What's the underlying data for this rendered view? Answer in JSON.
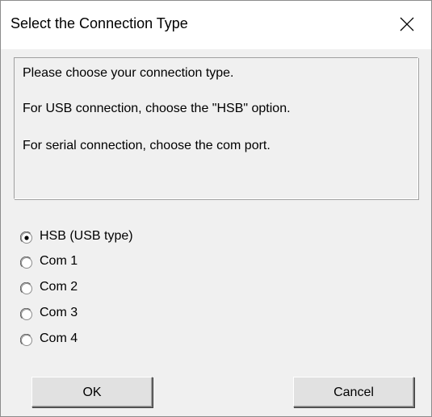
{
  "dialog": {
    "title": "Select the Connection Type",
    "close_icon": "close-icon"
  },
  "message": {
    "line1": "Please choose your connection type.",
    "line2": "For USB connection, choose the \"HSB\" option.",
    "line3": "For serial connection, choose the com port."
  },
  "options": {
    "selected_index": 0,
    "items": [
      {
        "label": "HSB (USB type)",
        "selected": true
      },
      {
        "label": "Com 1",
        "selected": false
      },
      {
        "label": "Com 2",
        "selected": false
      },
      {
        "label": "Com 3",
        "selected": false
      },
      {
        "label": "Com 4",
        "selected": false
      }
    ]
  },
  "buttons": {
    "ok_label": "OK",
    "cancel_label": "Cancel"
  },
  "colors": {
    "dialog_bg": "#f0f0f0",
    "titlebar_bg": "#ffffff",
    "button_bg": "#e1e1e1"
  }
}
